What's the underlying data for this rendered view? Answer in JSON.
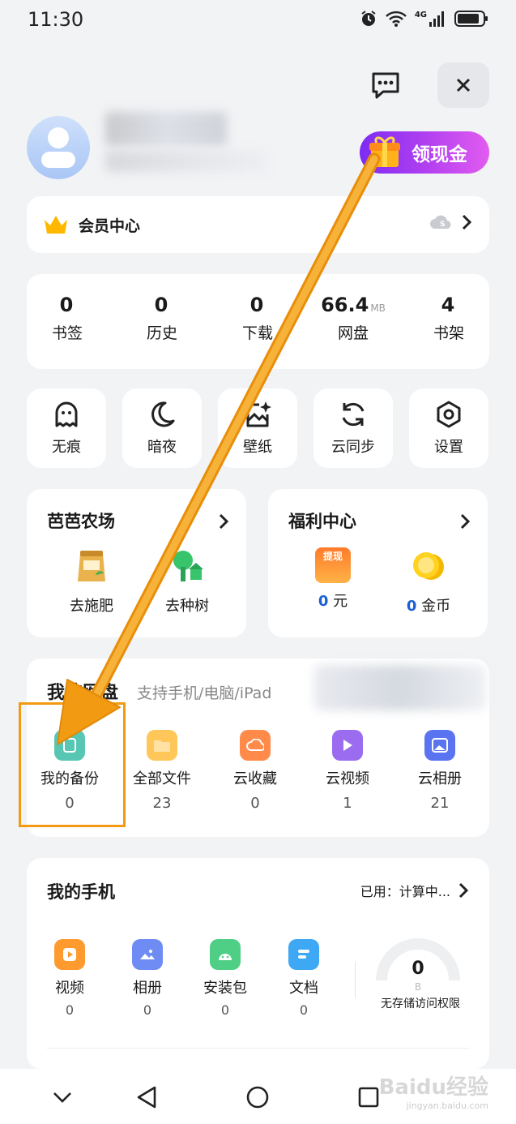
{
  "status": {
    "time": "11:30",
    "network": "4G"
  },
  "header": {
    "message_icon": "message-dots-icon",
    "close_icon": "close-icon"
  },
  "profile": {
    "cash_button": "领现金"
  },
  "vip": {
    "label": "会员中心"
  },
  "stats": [
    {
      "num": "0",
      "unit": "",
      "label": "书签"
    },
    {
      "num": "0",
      "unit": "",
      "label": "历史"
    },
    {
      "num": "0",
      "unit": "",
      "label": "下载"
    },
    {
      "num": "66.4",
      "unit": "MB",
      "label": "网盘"
    },
    {
      "num": "4",
      "unit": "",
      "label": "书架"
    }
  ],
  "tools": [
    {
      "label": "无痕",
      "icon": "ghost-icon"
    },
    {
      "label": "暗夜",
      "icon": "moon-icon"
    },
    {
      "label": "壁纸",
      "icon": "wallpaper-icon"
    },
    {
      "label": "云同步",
      "icon": "sync-icon"
    },
    {
      "label": "设置",
      "icon": "settings-icon"
    }
  ],
  "farm": {
    "title": "芭芭农场",
    "items": [
      {
        "label": "去施肥"
      },
      {
        "label": "去种树"
      }
    ]
  },
  "welfare": {
    "title": "福利中心",
    "cash_tag": "提现",
    "items": [
      {
        "value": "0",
        "label": "元"
      },
      {
        "value": "0",
        "label": "金币"
      }
    ]
  },
  "cloud": {
    "title": "我的网盘",
    "subtitle": "支持手机/电脑/iPad",
    "items": [
      {
        "label": "我的备份",
        "count": "0",
        "color": "#57c7b4"
      },
      {
        "label": "全部文件",
        "count": "23",
        "color": "#ffc75a"
      },
      {
        "label": "云收藏",
        "count": "0",
        "color": "#ff8a4a"
      },
      {
        "label": "云视频",
        "count": "1",
        "color": "#9b6cf0"
      },
      {
        "label": "云相册",
        "count": "21",
        "color": "#5a73f0"
      }
    ]
  },
  "phone": {
    "title": "我的手机",
    "used": "已用：计算中...",
    "items": [
      {
        "label": "视频",
        "count": "0",
        "color": "#ff9a2e"
      },
      {
        "label": "相册",
        "count": "0",
        "color": "#6f8cf5"
      },
      {
        "label": "安装包",
        "count": "0",
        "color": "#4fcf86"
      },
      {
        "label": "文档",
        "count": "0",
        "color": "#3fa8f4"
      }
    ],
    "gauge_value": "0",
    "gauge_unit": "B",
    "gauge_note": "无存储访问权限"
  },
  "watermark": {
    "main": "Baidu经验",
    "sub": "jingyan.baidu.com"
  },
  "colors": {
    "accent_orange": "#f29a12",
    "link_blue": "#1a5fd6",
    "cash_gradient_start": "#7d2cf2"
  }
}
